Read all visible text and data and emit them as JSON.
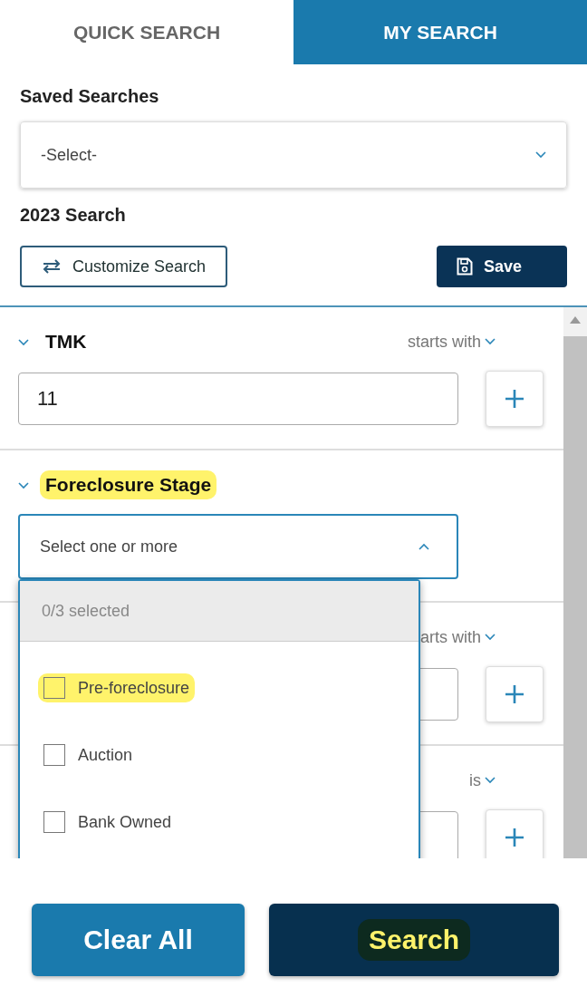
{
  "tabs": [
    {
      "label": "QUICK SEARCH",
      "selected": false
    },
    {
      "label": "MY SEARCH",
      "selected": true
    }
  ],
  "saved_searches": {
    "label": "Saved Searches",
    "value": "-Select-"
  },
  "current_search": "2023 Search",
  "actions": [
    {
      "label": "Customize Search",
      "kind": "outline"
    },
    {
      "label": "Save",
      "kind": "primary"
    }
  ],
  "filters": [
    {
      "title": "TMK",
      "operator": "starts with",
      "expanded": true,
      "kind": "text",
      "value": "11",
      "highlighted": false
    },
    {
      "title": "Foreclosure Stage",
      "expanded": true,
      "kind": "multiselect",
      "highlighted": true,
      "placeholder": "Select one or more",
      "open": true,
      "summary": "0/3 selected",
      "options": [
        {
          "label": "Pre-foreclosure",
          "checked": false,
          "highlighted": true
        },
        {
          "label": "Auction",
          "checked": false,
          "highlighted": false
        },
        {
          "label": "Bank Owned",
          "checked": false,
          "highlighted": false
        }
      ]
    },
    {
      "operator": "arts with",
      "kind": "text"
    },
    {
      "operator": "is",
      "kind": "text"
    }
  ],
  "footer": [
    {
      "label": "Clear All",
      "kind": "secondary",
      "highlighted": false
    },
    {
      "label": "Search",
      "kind": "primary",
      "highlighted": true
    }
  ]
}
